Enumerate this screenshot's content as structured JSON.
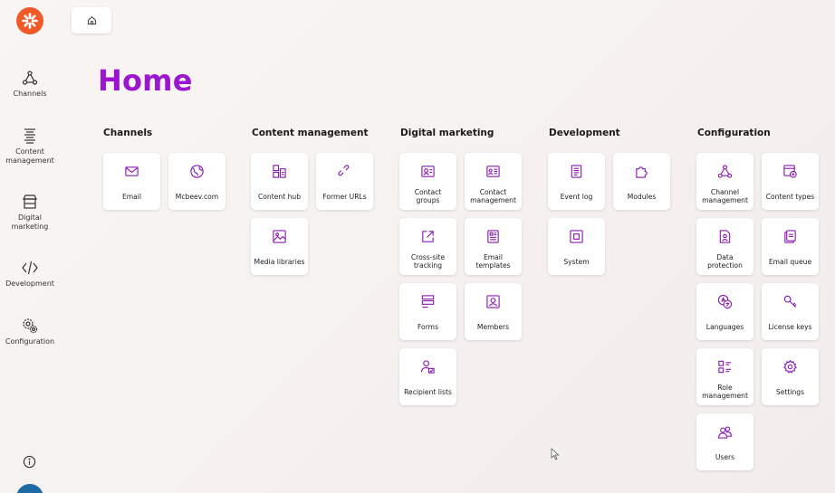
{
  "page": {
    "title": "Home"
  },
  "sidebar": {
    "items": [
      {
        "label": "Channels"
      },
      {
        "label": "Content management"
      },
      {
        "label": "Digital marketing"
      },
      {
        "label": "Development"
      },
      {
        "label": "Configuration"
      }
    ]
  },
  "colors": {
    "accent": "#9b16ce",
    "logo": "#f05a28",
    "avatar": "#1d6aa5"
  },
  "sections": [
    {
      "title": "Channels",
      "tiles": [
        {
          "label": "Email",
          "icon": "mail-icon"
        },
        {
          "label": "Mcbeev.com",
          "icon": "globe-icon"
        }
      ]
    },
    {
      "title": "Content management",
      "tiles": [
        {
          "label": "Content hub",
          "icon": "content-hub-icon"
        },
        {
          "label": "Former URLs",
          "icon": "link-icon"
        },
        {
          "label": "Media libraries",
          "icon": "image-icon"
        }
      ]
    },
    {
      "title": "Digital marketing",
      "tiles": [
        {
          "label": "Contact groups",
          "icon": "contact-card-icon"
        },
        {
          "label": "Contact management",
          "icon": "contact-list-icon"
        },
        {
          "label": "Cross-site tracking",
          "icon": "external-link-icon"
        },
        {
          "label": "Email templates",
          "icon": "template-icon"
        },
        {
          "label": "Forms",
          "icon": "form-icon"
        },
        {
          "label": "Members",
          "icon": "member-icon"
        },
        {
          "label": "Recipient lists",
          "icon": "recipient-icon"
        }
      ]
    },
    {
      "title": "Development",
      "tiles": [
        {
          "label": "Event log",
          "icon": "log-icon"
        },
        {
          "label": "Modules",
          "icon": "puzzle-icon"
        },
        {
          "label": "System",
          "icon": "system-icon"
        }
      ]
    },
    {
      "title": "Configuration",
      "tiles": [
        {
          "label": "Channel management",
          "icon": "channels-icon"
        },
        {
          "label": "Content types",
          "icon": "content-types-icon"
        },
        {
          "label": "Data protection",
          "icon": "data-protection-icon"
        },
        {
          "label": "Email queue",
          "icon": "email-queue-icon"
        },
        {
          "label": "Languages",
          "icon": "languages-icon"
        },
        {
          "label": "License keys",
          "icon": "key-icon"
        },
        {
          "label": "Role management",
          "icon": "role-icon"
        },
        {
          "label": "Settings",
          "icon": "gear-icon"
        },
        {
          "label": "Users",
          "icon": "users-icon"
        }
      ]
    }
  ]
}
